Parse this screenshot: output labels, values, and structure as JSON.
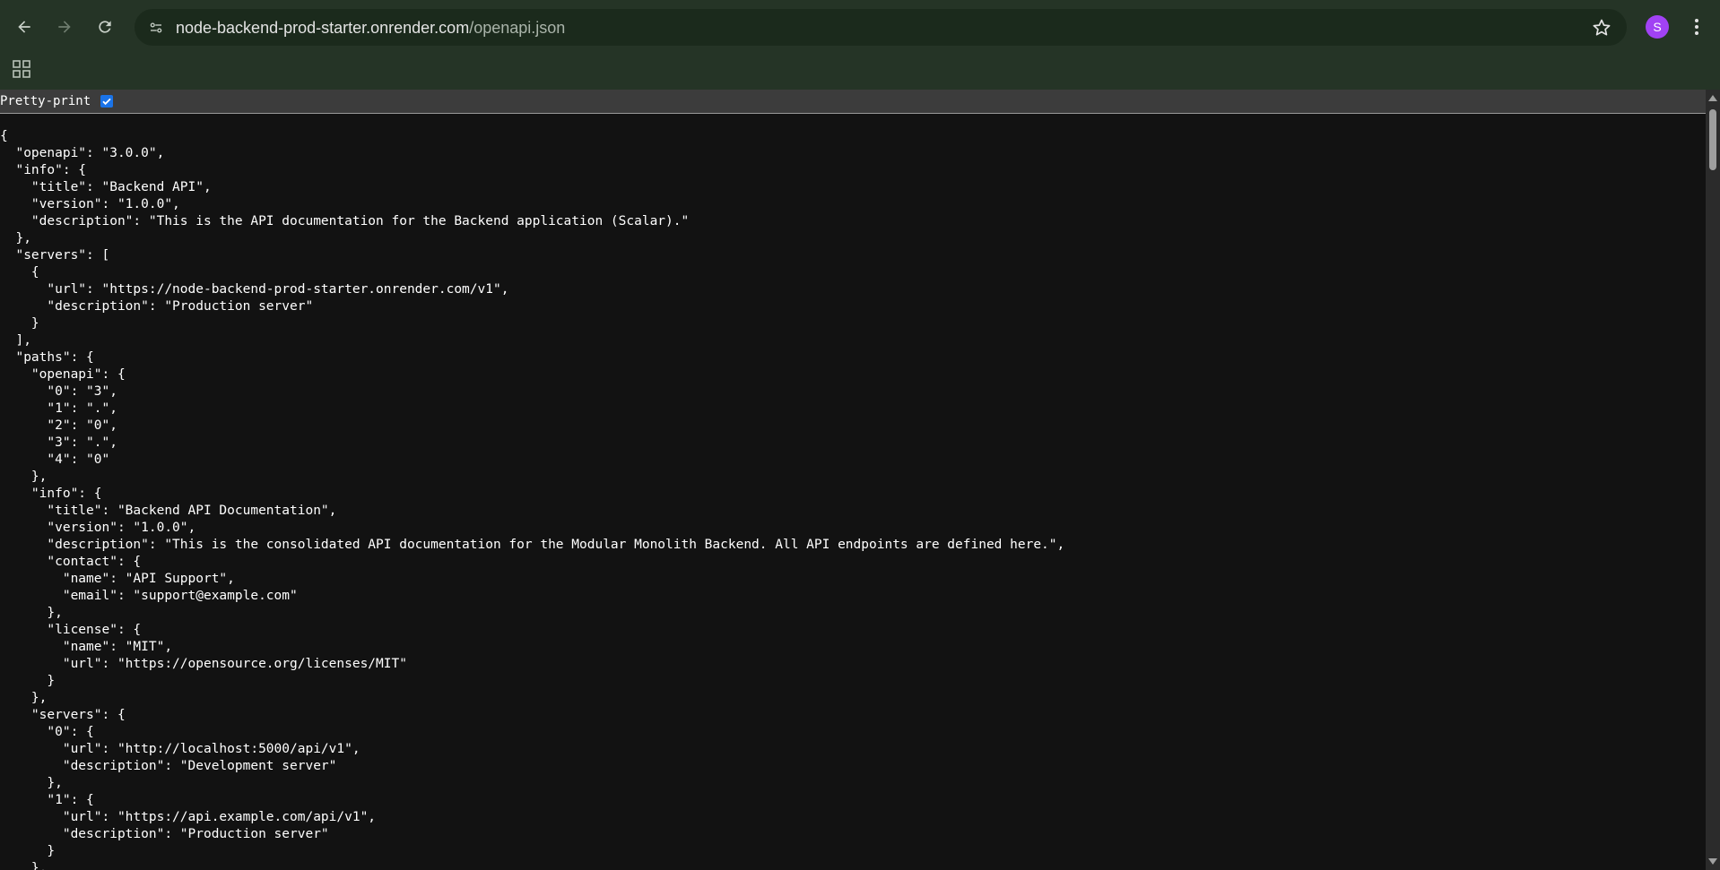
{
  "browser": {
    "url_host": "node-backend-prod-starter.onrender.com",
    "url_path": "/openapi.json",
    "profile_initial": "S",
    "profile_color": "#a142f4",
    "icons": {
      "back": "arrow-left-icon",
      "forward": "arrow-right-icon",
      "reload": "reload-icon",
      "site_info": "tune-icon",
      "bookmark": "star-icon",
      "menu": "kebab-menu-icon",
      "apps": "apps-grid-icon"
    }
  },
  "pretty_print": {
    "label": "Pretty-print",
    "checked": true
  },
  "json_lines": [
    "{",
    "  \"openapi\": \"3.0.0\",",
    "  \"info\": {",
    "    \"title\": \"Backend API\",",
    "    \"version\": \"1.0.0\",",
    "    \"description\": \"This is the API documentation for the Backend application (Scalar).\"",
    "  },",
    "  \"servers\": [",
    "    {",
    "      \"url\": \"https://node-backend-prod-starter.onrender.com/v1\",",
    "      \"description\": \"Production server\"",
    "    }",
    "  ],",
    "  \"paths\": {",
    "    \"openapi\": {",
    "      \"0\": \"3\",",
    "      \"1\": \".\",",
    "      \"2\": \"0\",",
    "      \"3\": \".\",",
    "      \"4\": \"0\"",
    "    },",
    "    \"info\": {",
    "      \"title\": \"Backend API Documentation\",",
    "      \"version\": \"1.0.0\",",
    "      \"description\": \"This is the consolidated API documentation for the Modular Monolith Backend. All API endpoints are defined here.\",",
    "      \"contact\": {",
    "        \"name\": \"API Support\",",
    "        \"email\": \"support@example.com\"",
    "      },",
    "      \"license\": {",
    "        \"name\": \"MIT\",",
    "        \"url\": \"https://opensource.org/licenses/MIT\"",
    "      }",
    "    },",
    "    \"servers\": {",
    "      \"0\": {",
    "        \"url\": \"http://localhost:5000/api/v1\",",
    "        \"description\": \"Development server\"",
    "      },",
    "      \"1\": {",
    "        \"url\": \"https://api.example.com/api/v1\",",
    "        \"description\": \"Production server\"",
    "      }",
    "    },"
  ]
}
